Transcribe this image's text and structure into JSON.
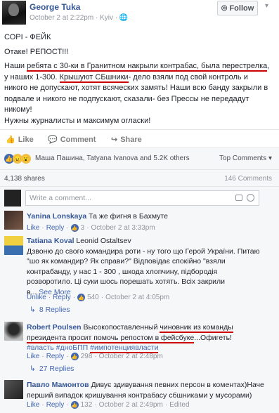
{
  "post": {
    "author": "George Tuka",
    "meta": "October 2 at 2:22pm · Kyiv · ",
    "follow_label": "Follow",
    "lines": {
      "l1": "СОРІ - ФЕЙК",
      "l2": "Отаке! РЕПОСТ!!!",
      "l3a": "Наши ",
      "l3b": "ребята с 30-ки в Гранитном накрыли контрабас, была перестрелка",
      "l3c": ",",
      "l4": "у наших 1-300. ",
      "l4b": "Крышуют СБшники",
      "l4c": "- дело взяли под свой контроль и",
      "l5": "никого не допускают, хотят всяческих замять! Наши всю банду закрыли в",
      "l6": "подвале и никого не подпускают, сказали- без Прессы не передадут",
      "l7": "никому!",
      "l8": "Нужны журналисты и максимум огласки!"
    },
    "actions": {
      "like": "Like",
      "comment": "Comment",
      "share": "Share"
    },
    "reactions_text": "Маша Пашина, Tatyana Ivanova and 5.2K others",
    "top_comments": "Top Comments ▾",
    "shares": "4,138 shares",
    "comments_count": "146 Comments",
    "write_placeholder": "Write a comment..."
  },
  "comments": [
    {
      "name": "Yanina Lonskaya",
      "text": "Та же фигня в Бахмуте",
      "like": "Like",
      "reply": "Reply",
      "likes": "3",
      "time": "October 2 at 3:33pm"
    },
    {
      "name": "Tatiana Koval",
      "mention": "Leonid Ostaltsev",
      "l1": "Дзвоню до свого командира роти - ну того що Герой України. Питаю",
      "l2": "\"шо як командир? Як справи?\" Відповідає спокійно \"взяли",
      "l3": "контрабанду, у нас 1 - 300 , шкода хлопчину, підбородія",
      "l4": "розворотило. Ці суки шось порешать хотять. Всіх закрили",
      "l5": "в... ",
      "see_more": "See More",
      "unlike": "Unlike",
      "reply": "Reply",
      "likes": "540",
      "time": "October 2 at 4:05pm",
      "replies": "8 Replies"
    },
    {
      "name": "Robert Poulsen",
      "t1": "Высокопоставленный ",
      "t1b": "чиновник из команды",
      "t2": "президента просит помочь репостом в фейсбуке",
      "t2b": "...Офигеть!",
      "tag1": "#власть",
      "tag2": "#дноБПП",
      "tag3": "#импотенциявласти",
      "like": "Like",
      "reply": "Reply",
      "likes": "298",
      "time": "October 2 at 2:48pm",
      "replies": "27 Replies"
    },
    {
      "name": "Павло Мамонтов",
      "t1": "Дивує здивування певних персон в коментах)Наче",
      "t2": "перший випадок кришування контрабасу сбшниками у мусорами)",
      "like": "Like",
      "reply": "Reply",
      "likes": "132",
      "time": "October 2 at 2:49pm",
      "edited": "Edited"
    }
  ]
}
